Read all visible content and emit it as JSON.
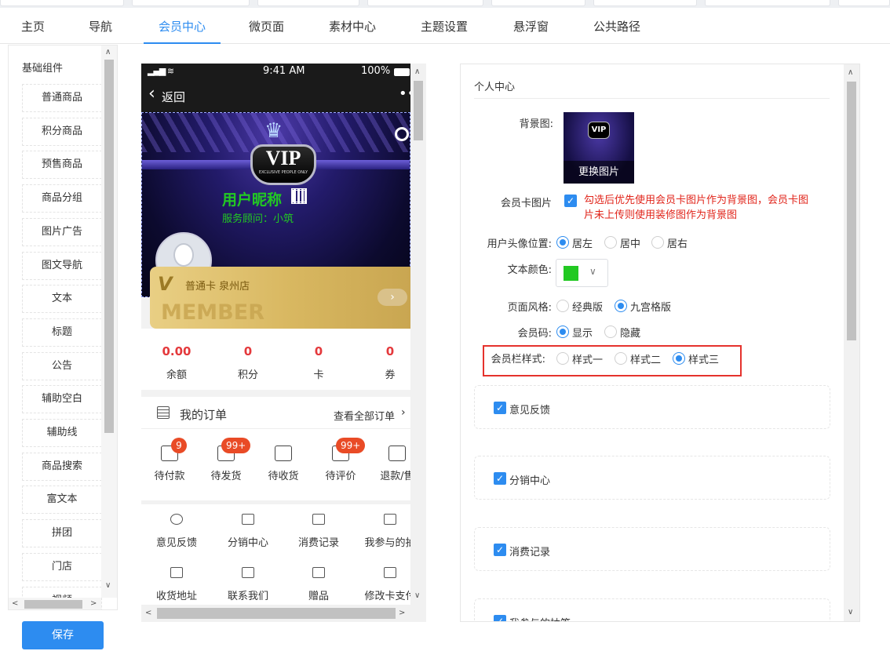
{
  "tabs": [
    "主页",
    "导航",
    "会员中心",
    "微页面",
    "素材中心",
    "主题设置",
    "悬浮窗",
    "公共路径"
  ],
  "active_tab": "会员中心",
  "sidebar": {
    "title": "基础组件",
    "items": [
      "普通商品",
      "积分商品",
      "预售商品",
      "商品分组",
      "图片广告",
      "图文导航",
      "文本",
      "标题",
      "公告",
      "辅助空白",
      "辅助线",
      "商品搜索",
      "富文本",
      "拼团",
      "门店",
      "视频"
    ]
  },
  "save_label": "保存",
  "phone": {
    "status": {
      "time": "9:41 AM",
      "battery": "100%"
    },
    "back_label": "返回",
    "nickname": "用户昵称",
    "advisor": "服务顾问：小筑",
    "vip_text": "VIP",
    "vip_sub": "EXCLUSIVE PEOPLE ONLY",
    "card_name": "普通卡 泉州店",
    "card_watermark": "MEMBER",
    "stats": [
      {
        "value": "0.00",
        "label": "余额"
      },
      {
        "value": "0",
        "label": "积分"
      },
      {
        "value": "0",
        "label": "卡"
      },
      {
        "value": "0",
        "label": "券"
      }
    ],
    "orders_title": "我的订单",
    "orders_all": "查看全部订单",
    "orders": [
      {
        "label": "待付款",
        "badge": "9",
        "icon": "wallet-icon"
      },
      {
        "label": "待发货",
        "badge": "99+",
        "icon": "box-icon"
      },
      {
        "label": "待收货",
        "badge": "",
        "icon": "truck-icon"
      },
      {
        "label": "待评价",
        "badge": "99+",
        "icon": "comment-icon"
      },
      {
        "label": "退款/售",
        "badge": "",
        "icon": "calendar-icon"
      }
    ],
    "grid": [
      {
        "label": "意见反馈",
        "icon": "chat-bubble-icon"
      },
      {
        "label": "分销中心",
        "icon": "users-icon"
      },
      {
        "label": "消费记录",
        "icon": "cart-icon"
      },
      {
        "label": "我参与的抽",
        "icon": "basket-icon"
      },
      {
        "label": "收货地址",
        "icon": "location-pin-icon"
      },
      {
        "label": "联系我们",
        "icon": "phone-icon"
      },
      {
        "label": "赠品",
        "icon": "gift-box-icon"
      },
      {
        "label": "修改卡支付",
        "icon": "edit-icon"
      }
    ]
  },
  "settings": {
    "section_title": "个人中心",
    "bg_label": "背景图:",
    "bg_change": "更换图片",
    "vip_text": "VIP",
    "card_img_label": "会员卡图片",
    "card_img_hint": "勾选后优先使用会员卡图片作为背景图，会员卡图片未上传则使用装修图作为背景图",
    "avatar_pos_label": "用户头像位置:",
    "avatar_pos_options": [
      "居左",
      "居中",
      "居右"
    ],
    "text_color_label": "文本颜色:",
    "text_color_value": "#22c922",
    "page_style_label": "页面风格:",
    "page_style_options": [
      "经典版",
      "九宫格版"
    ],
    "member_code_label": "会员码:",
    "member_code_options": [
      "显示",
      "隐藏"
    ],
    "bar_style_label": "会员栏样式:",
    "bar_style_options": [
      "样式一",
      "样式二",
      "样式三"
    ],
    "modules": [
      "意见反馈",
      "分销中心",
      "消费记录",
      "我参与的抽签"
    ]
  },
  "colors": {
    "accent": "#2d8cf0",
    "price_red": "#e4393c",
    "highlight_border": "#e5322d",
    "nickname_green": "#22c922"
  }
}
